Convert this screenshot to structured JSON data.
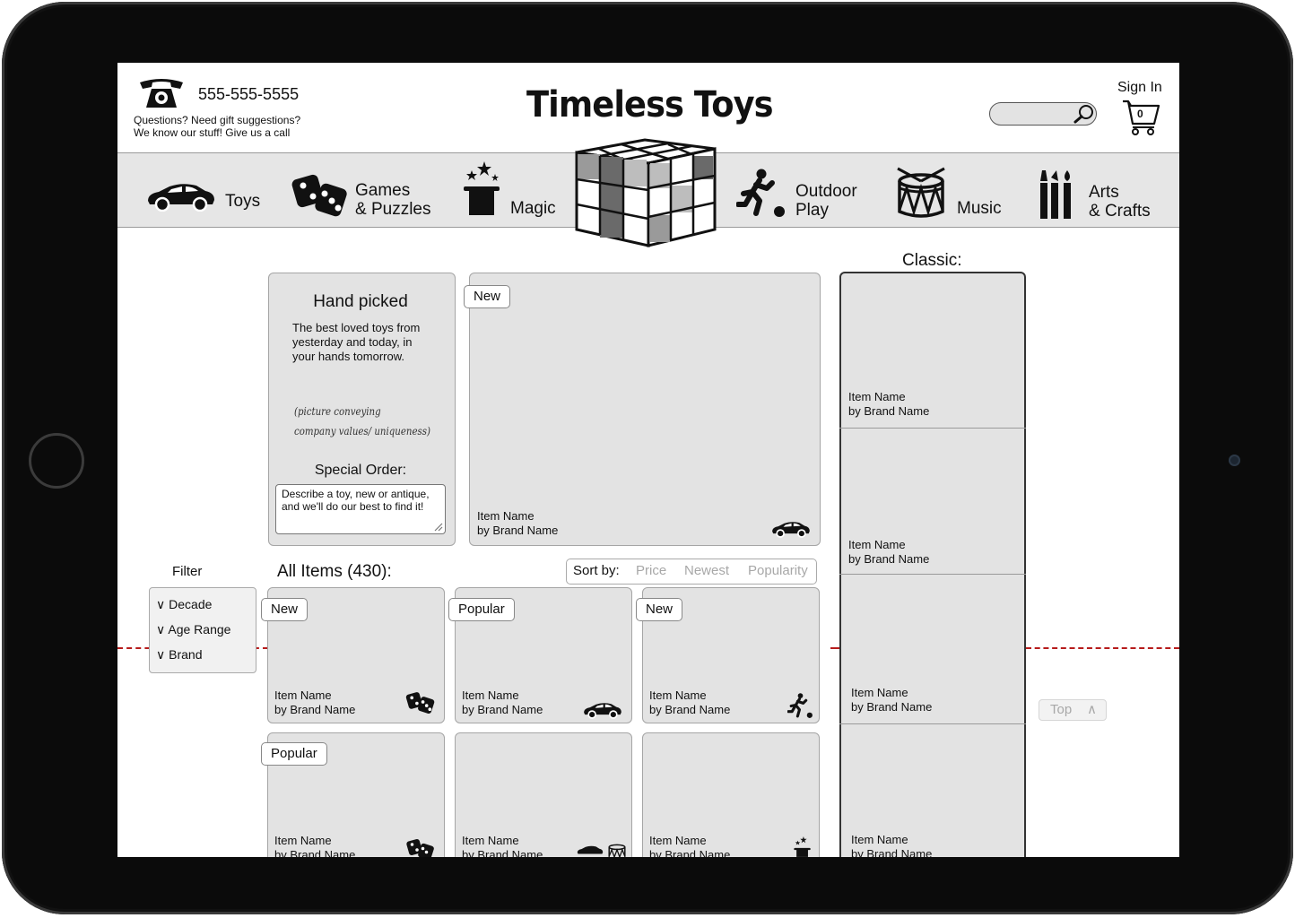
{
  "header": {
    "phone": "555-555-5555",
    "help_line1": "Questions? Need gift suggestions?",
    "help_line2": "We know our stuff! Give us a call",
    "logo": "Timeless Toys",
    "signin": "Sign In",
    "cart_count": "0"
  },
  "nav": {
    "toys": "Toys",
    "games_l1": "Games",
    "games_l2": "& Puzzles",
    "magic": "Magic",
    "outdoor_l1": "Outdoor",
    "outdoor_l2": "Play",
    "music": "Music",
    "arts_l1": "Arts",
    "arts_l2": "& Crafts"
  },
  "handpicked": {
    "title": "Hand picked",
    "line1": "The best loved toys from",
    "line2": "yesterday and today, in",
    "line3": "your hands tomorrow.",
    "note1": "(picture conveying",
    "note2": "company values/ uniqueness)",
    "special_title": "Special Order:",
    "special_line1": "Describe a toy, new or antique,",
    "special_line2": "and we'll do our best to find it!"
  },
  "featured": {
    "tag": "New",
    "name": "Item Name",
    "brand": "by Brand Name",
    "icon": "car-icon"
  },
  "classic": {
    "title": "Classic:",
    "items": [
      {
        "name": "Item Name",
        "brand": "by Brand Name"
      },
      {
        "name": "Item Name",
        "brand": "by Brand Name"
      },
      {
        "name": "Item Name",
        "brand": "by Brand Name"
      },
      {
        "name": "Item Name",
        "brand": "by Brand Name"
      }
    ]
  },
  "filter": {
    "label": "Filter",
    "decade": "Decade",
    "age": "Age Range",
    "brand": "Brand"
  },
  "listing": {
    "title": "All Items (430):",
    "sort_label": "Sort by:",
    "sort_price": "Price",
    "sort_newest": "Newest",
    "sort_popularity": "Popularity"
  },
  "grid": [
    {
      "tag": "New",
      "name": "Item Name",
      "brand": "by Brand Name",
      "icon": "dice-icon"
    },
    {
      "tag": "Popular",
      "name": "Item Name",
      "brand": "by Brand Name",
      "icon": "car-icon"
    },
    {
      "tag": "New",
      "name": "Item Name",
      "brand": "by Brand Name",
      "icon": "runner-icon"
    },
    {
      "tag": "Popular",
      "name": "Item Name",
      "brand": "by Brand Name",
      "icon": "dice-icon"
    },
    {
      "tag": "",
      "name": "Item Name",
      "brand": "by Brand Name",
      "icon": "car-drum-icon"
    },
    {
      "tag": "",
      "name": "Item Name",
      "brand": "by Brand Name",
      "icon": "magic-hat-icon"
    }
  ],
  "top_button": "Top",
  "colors": {
    "panel": "#e3e3e3",
    "nav_bg": "#e6e6e6",
    "dashed_line": "#b71c1c",
    "muted": "#a8a8a8"
  }
}
